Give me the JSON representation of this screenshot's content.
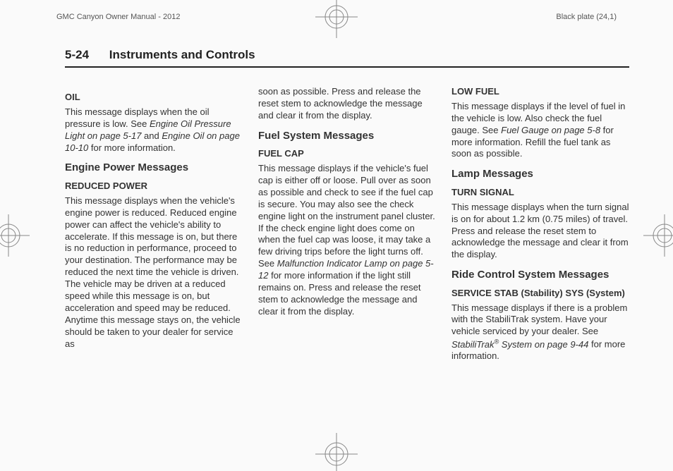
{
  "header": {
    "manual_title": "GMC Canyon Owner Manual - 2012",
    "plate": "Black plate (24,1)"
  },
  "running_head": {
    "page_number": "5-24",
    "section": "Instruments and Controls"
  },
  "col1": {
    "oil": {
      "heading": "OIL",
      "p1a": "This message displays when the oil pressure is low. See ",
      "ref1": "Engine Oil Pressure Light on page 5-17",
      "p1b": " and ",
      "ref2": "Engine Oil on page 10-10",
      "p1c": " for more information."
    },
    "engine_power": {
      "heading": "Engine Power Messages",
      "sub": "REDUCED POWER",
      "p": "This message displays when the vehicle's engine power is reduced. Reduced engine power can affect the vehicle's ability to accelerate. If this message is on, but there is no reduction in performance, proceed to your destination. The performance may be reduced the next time the vehicle is driven. The vehicle may be driven at a reduced speed while this message is on, but acceleration and speed may be reduced. Anytime this message stays on, the vehicle should be taken to your dealer for service as"
    }
  },
  "col2": {
    "cont": "soon as possible. Press and release the reset stem to acknowledge the message and clear it from the display.",
    "fuel_system": {
      "heading": "Fuel System Messages",
      "sub": "FUEL CAP",
      "p1a": "This message displays if the vehicle's fuel cap is either off or loose. Pull over as soon as possible and check to see if the fuel cap is secure. You may also see the check engine light on the instrument panel cluster. If the check engine light does come on when the fuel cap was loose, it may take a few driving trips before the light turns off. See ",
      "ref": "Malfunction Indicator Lamp on page 5-12",
      "p1b": " for more information if the light still remains on. Press and release the reset stem to acknowledge the message and clear it from the display."
    }
  },
  "col3": {
    "low_fuel": {
      "heading": "LOW FUEL",
      "p1a": "This message displays if the level of fuel in the vehicle is low. Also check the fuel gauge. See ",
      "ref": "Fuel Gauge on page 5-8",
      "p1b": " for more information. Refill the fuel tank as soon as possible."
    },
    "lamp": {
      "heading": "Lamp Messages",
      "sub": "TURN SIGNAL",
      "p": "This message displays when the turn signal is on for about 1.2 km (0.75 miles) of travel. Press and release the reset stem to acknowledge the message and clear it from the display."
    },
    "ride": {
      "heading": "Ride Control System Messages",
      "sub": "SERVICE STAB (Stability) SYS (System)",
      "p1a": "This message displays if there is a problem with the StabiliTrak system. Have your vehicle serviced by your dealer. See ",
      "ref_a": "StabiliTrak",
      "ref_b": " System on page 9-44",
      "p1b": " for more information."
    }
  }
}
